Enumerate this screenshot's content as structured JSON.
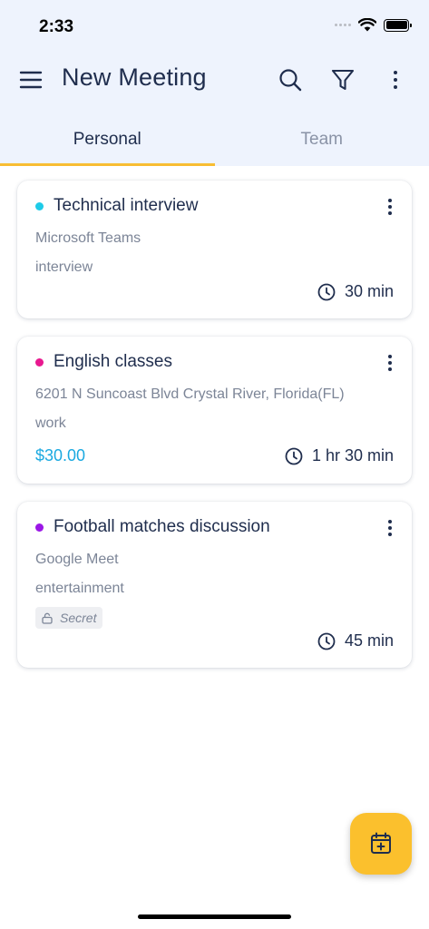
{
  "status_bar": {
    "time": "2:33"
  },
  "app_bar": {
    "title": "New Meeting",
    "icons": [
      "menu-icon",
      "search-icon",
      "filter-icon",
      "more-vertical-icon"
    ]
  },
  "tabs": [
    {
      "label": "Personal",
      "active": true
    },
    {
      "label": "Team",
      "active": false
    }
  ],
  "meetings": [
    {
      "title": "Technical interview",
      "dot_color": "#1ecbe8",
      "location": "Microsoft Teams",
      "category": "interview",
      "duration": "30 min"
    },
    {
      "title": "English classes",
      "dot_color": "#e8188f",
      "location": "6201 N Suncoast Blvd Crystal River, Florida(FL)",
      "category": "work",
      "price": "$30.00",
      "duration": "1 hr 30 min"
    },
    {
      "title": "Football matches discussion",
      "dot_color": "#9b17e6",
      "location": "Google Meet",
      "category": "entertainment",
      "badge": "Secret",
      "duration": "45 min"
    }
  ],
  "colors": {
    "accent": "#f8bd33",
    "header_bg": "#eef3fd",
    "price": "#1aa9e0",
    "fab": "#fbc02d"
  },
  "fab": {
    "icon": "calendar-add-icon"
  }
}
